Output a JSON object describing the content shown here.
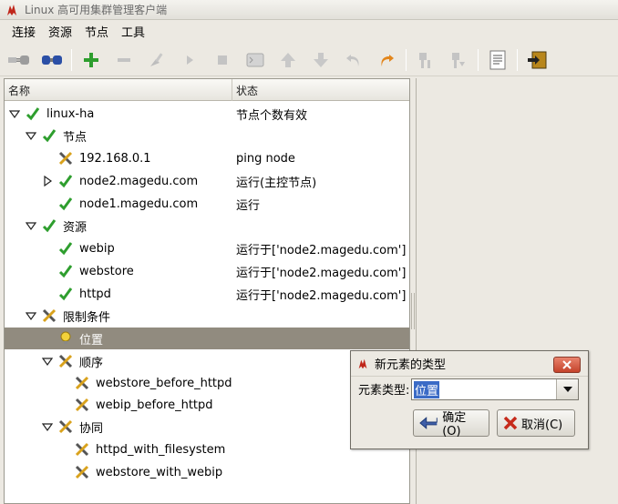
{
  "window": {
    "title": "Linux 高可用集群管理客户端",
    "app_icon": "linux-ha-icon"
  },
  "menubar": {
    "items": [
      "连接",
      "资源",
      "节点",
      "工具"
    ]
  },
  "toolbar": {
    "buttons": [
      "connect",
      "disconnect",
      "add",
      "remove",
      "cleanup",
      "start",
      "stop",
      "console",
      "move-up",
      "move-down",
      "undo",
      "redo",
      "standby",
      "active",
      "log",
      "exit"
    ]
  },
  "tree": {
    "columns": {
      "name": "名称",
      "status": "状态"
    },
    "rows": [
      {
        "label": "linux-ha",
        "status": "节点个数有效",
        "icon": "check-icon"
      },
      {
        "label": "节点",
        "status": "",
        "icon": "check-icon"
      },
      {
        "label": "192.168.0.1",
        "status": "ping node",
        "icon": "tools-icon"
      },
      {
        "label": "node2.magedu.com",
        "status": "运行(主控节点)",
        "icon": "check-icon"
      },
      {
        "label": "node1.magedu.com",
        "status": "运行",
        "icon": "check-icon"
      },
      {
        "label": "资源",
        "status": "",
        "icon": "check-icon"
      },
      {
        "label": "webip",
        "status": "运行于['node2.magedu.com']",
        "icon": "check-icon"
      },
      {
        "label": "webstore",
        "status": "运行于['node2.magedu.com']",
        "icon": "check-icon"
      },
      {
        "label": "httpd",
        "status": "运行于['node2.magedu.com']",
        "icon": "check-icon"
      },
      {
        "label": "限制条件",
        "status": "",
        "icon": "tools-icon"
      },
      {
        "label": "位置",
        "status": "",
        "icon": "lightbulb-icon"
      },
      {
        "label": "顺序",
        "status": "",
        "icon": "tools-icon"
      },
      {
        "label": "webstore_before_httpd",
        "status": "",
        "icon": "tools-icon"
      },
      {
        "label": "webip_before_httpd",
        "status": "",
        "icon": "tools-icon"
      },
      {
        "label": "协同",
        "status": "",
        "icon": "tools-icon"
      },
      {
        "label": "httpd_with_filesystem",
        "status": "",
        "icon": "tools-icon"
      },
      {
        "label": "webstore_with_webip",
        "status": "",
        "icon": "tools-icon"
      }
    ],
    "selected_row": "位置"
  },
  "dialog": {
    "title": "新元素的类型",
    "field_label": "元素类型:",
    "field_value": "位置",
    "ok_label": "确定(O)",
    "cancel_label": "取消(C)"
  },
  "colors": {
    "check": "#2e9e2e",
    "selection": "#918b7f",
    "accent": "#3b6bc6"
  }
}
